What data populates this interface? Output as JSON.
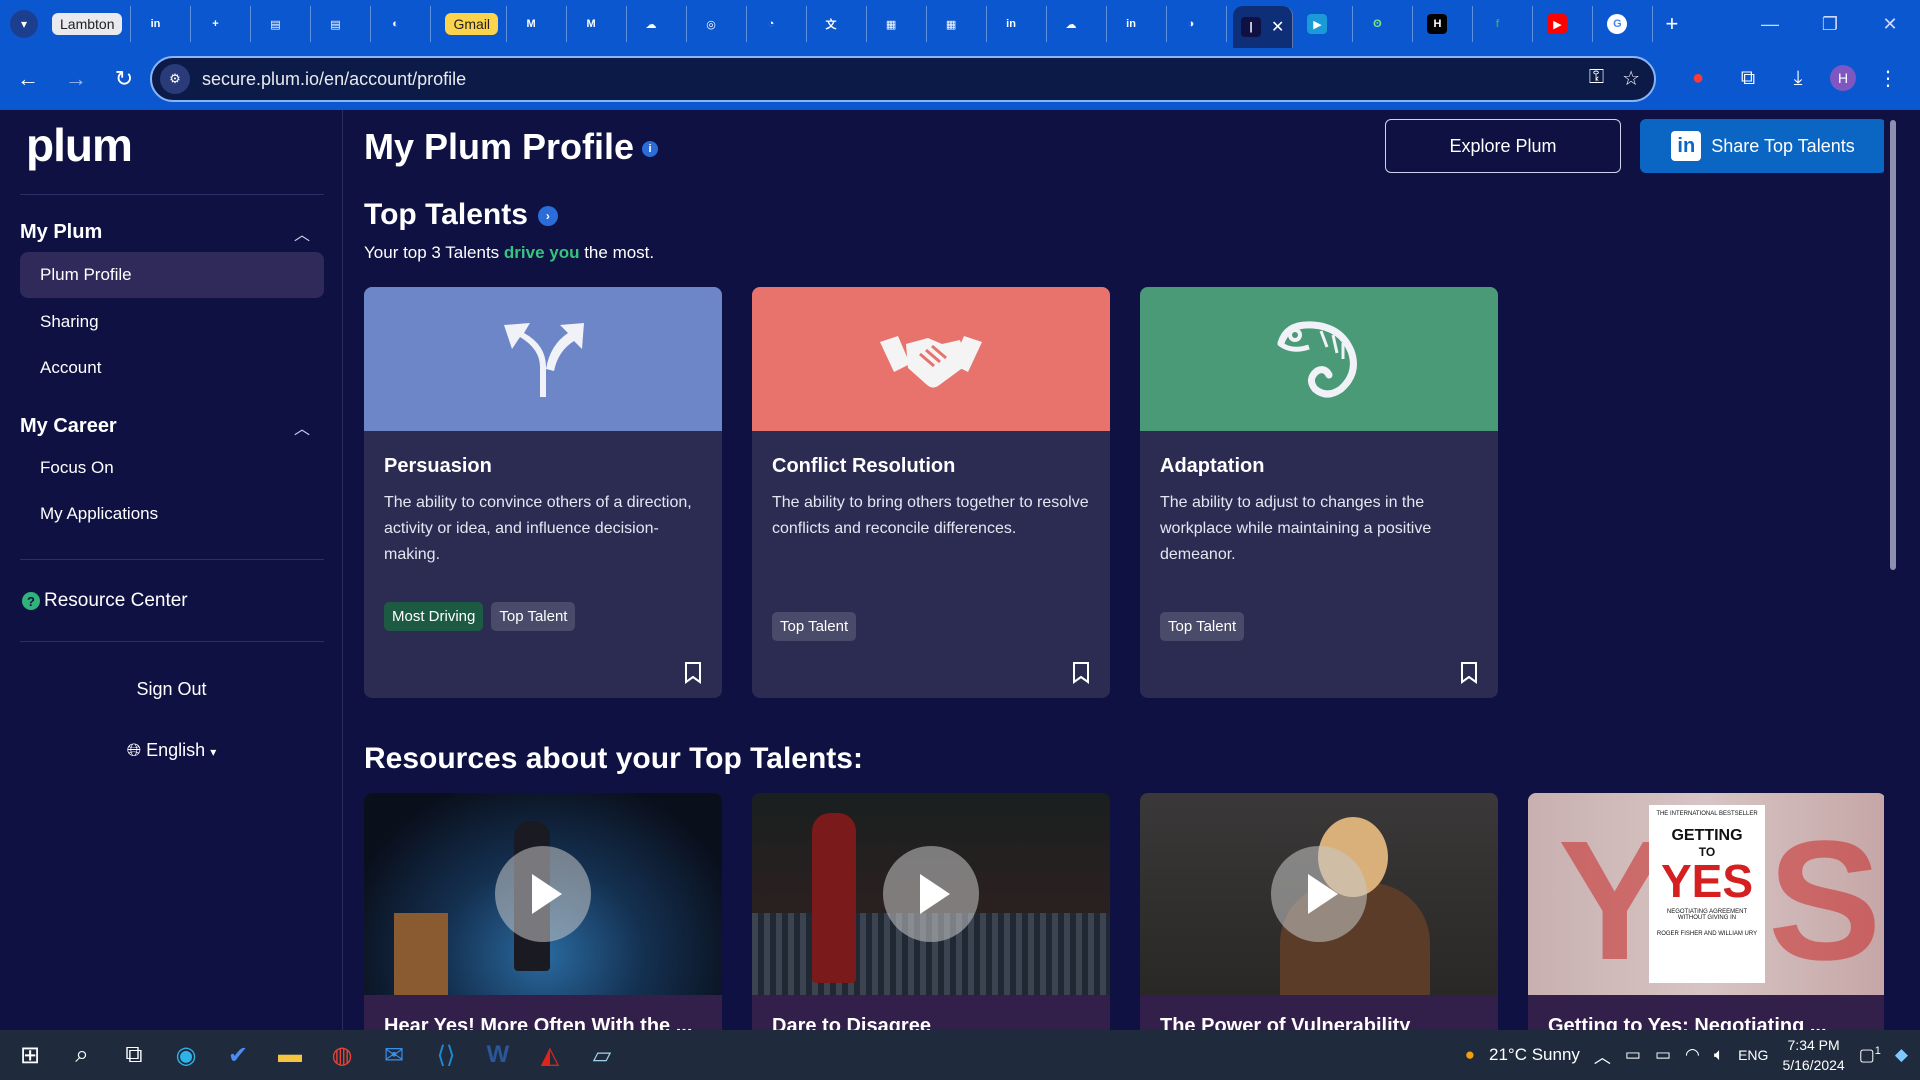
{
  "browser": {
    "tabs": [
      {
        "label": "Lambton",
        "style": "pill"
      },
      {
        "label": "",
        "icon": "in"
      },
      {
        "label": "",
        "icon": "+"
      },
      {
        "label": "",
        "icon": "▤"
      },
      {
        "label": "",
        "icon": "▤"
      },
      {
        "label": "",
        "icon": "◐"
      },
      {
        "label": "Gmail",
        "style": "gmail"
      },
      {
        "label": "",
        "icon": "M"
      },
      {
        "label": "",
        "icon": "M"
      },
      {
        "label": "",
        "icon": "☁"
      },
      {
        "label": "",
        "icon": "◎"
      },
      {
        "label": "",
        "icon": "◔"
      },
      {
        "label": "",
        "icon": "文"
      },
      {
        "label": "",
        "icon": "▦"
      },
      {
        "label": "",
        "icon": "▦"
      },
      {
        "label": "",
        "icon": "in"
      },
      {
        "label": "",
        "icon": "☁"
      },
      {
        "label": "",
        "icon": "in"
      },
      {
        "label": "",
        "icon": "◑"
      }
    ],
    "active_tab_close": "✕",
    "url": "secure.plum.io/en/account/profile",
    "new_tab": "+",
    "profile_initial": "H"
  },
  "sidebar": {
    "logo": "plum",
    "groups": [
      {
        "label": "My Plum",
        "items": [
          "Plum Profile",
          "Sharing",
          "Account"
        ]
      },
      {
        "label": "My Career",
        "items": [
          "Focus On",
          "My Applications"
        ]
      }
    ],
    "resource_center": "Resource Center",
    "sign_out": "Sign Out",
    "language": "English"
  },
  "main": {
    "title": "My Plum Profile",
    "explore_button": "Explore Plum",
    "share_button": "Share Top Talents",
    "section_title": "Top Talents",
    "subtitle_before": "Your top 3 Talents ",
    "subtitle_highlight": "drive you",
    "subtitle_after": " the most.",
    "talents": [
      {
        "name": "Persuasion",
        "description": "The ability to convince others of a direction, activity or idea, and influence decision-making.",
        "tags": [
          "Most Driving",
          "Top Talent"
        ],
        "color": "#6c86c8"
      },
      {
        "name": "Conflict Resolution",
        "description": "The ability to bring others together to resolve conflicts and reconcile differences.",
        "tags": [
          "Top Talent"
        ],
        "color": "#e8736c"
      },
      {
        "name": "Adaptation",
        "description": "The ability to adjust to changes in the workplace while maintaining a positive demeanor.",
        "tags": [
          "Top Talent"
        ],
        "color": "#4a9a78"
      }
    ],
    "resources_title": "Resources about your Top Talents:",
    "resources": [
      {
        "title": "Hear Yes! More Often With the ..."
      },
      {
        "title": "Dare to Disagree"
      },
      {
        "title": "The Power of Vulnerability"
      },
      {
        "title": "Getting to Yes: Negotiating ..."
      }
    ],
    "book_cover": {
      "top": "THE INTERNATIONAL BESTSELLER",
      "line1": "GETTING",
      "line2": "TO",
      "line3": "YES",
      "subtitle": "NEGOTIATING AGREEMENT WITHOUT GIVING IN",
      "authors": "ROGER FISHER AND WILLIAM URY"
    }
  },
  "taskbar": {
    "weather": "21°C  Sunny",
    "lang": "ENG",
    "time": "7:34 PM",
    "date": "5/16/2024",
    "notifications": "1"
  },
  "colors": {
    "page_bg": "#0e1142",
    "card_bg": "#2c2b52",
    "linkedin": "#0a66c2",
    "highlight_green": "#36c47d"
  }
}
